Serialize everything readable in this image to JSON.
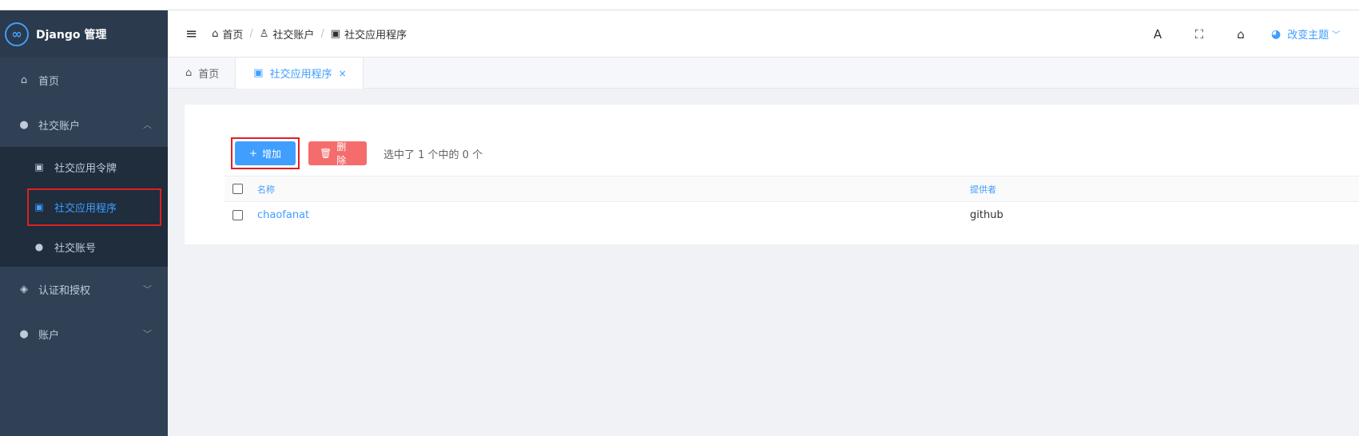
{
  "app": {
    "title": "Django 管理",
    "logo_glyph": "∞"
  },
  "sidebar": {
    "items": [
      {
        "label": "首页",
        "icon": "home-icon",
        "glyph": "⌂"
      },
      {
        "label": "社交账户",
        "icon": "user-icon",
        "glyph": "●",
        "arrow": "︿"
      },
      {
        "label": "认证和授权",
        "icon": "shield-icon",
        "glyph": "◈",
        "arrow": "﹀"
      },
      {
        "label": "账户",
        "icon": "user-icon",
        "glyph": "●",
        "arrow": "﹀"
      }
    ],
    "subitems": [
      {
        "label": "社交应用令牌",
        "icon": "image-icon",
        "glyph": "▣"
      },
      {
        "label": "社交应用程序",
        "icon": "image-icon",
        "glyph": "▣"
      },
      {
        "label": "社交账号",
        "icon": "circle-icon",
        "glyph": "●"
      }
    ]
  },
  "header": {
    "menu_glyph": "≡",
    "breadcrumb": [
      {
        "label": "首页",
        "glyph": "⌂"
      },
      {
        "label": "社交账户",
        "glyph": "♙"
      },
      {
        "label": "社交应用程序",
        "glyph": "▣"
      }
    ],
    "separator": "/",
    "font_glyph": "A",
    "fullscreen_glyph": "⛶",
    "home_glyph": "⌂",
    "theme_glyph": "◕",
    "theme_label": "改变主题",
    "theme_arrow": "﹀"
  },
  "tabs": [
    {
      "label": "首页",
      "glyph": "⌂"
    },
    {
      "label": "社交应用程序",
      "glyph": "▣",
      "close": "×"
    }
  ],
  "toolbar": {
    "add_label": "增加",
    "add_glyph": "+",
    "delete_label": "删除",
    "delete_glyph": "🗑",
    "selection_text": "选中了 1 个中的 0 个"
  },
  "table": {
    "headers": [
      "名称",
      "提供者"
    ],
    "rows": [
      {
        "name": "chaofanat",
        "provider": "github"
      }
    ]
  },
  "colors": {
    "accent": "#409eff",
    "danger": "#f56c6c",
    "sidebar": "#304156",
    "highlight": "#e02020"
  }
}
